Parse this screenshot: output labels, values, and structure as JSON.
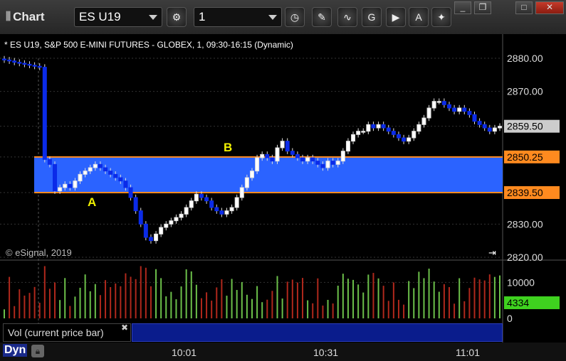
{
  "window": {
    "title": "Chart",
    "min": "_",
    "restore": "❐",
    "max": "□",
    "close": "✕"
  },
  "toolbar": {
    "symbol": "ES U19",
    "interval": "1"
  },
  "chart_info": "* ES U19, S&P 500 E-MINI FUTURES - GLOBEX, 1, 09:30-16:15 (Dynamic)",
  "copyright": "© eSignal, 2019",
  "vol_legend": "Vol (current price bar)",
  "bottom": {
    "dyn": "Dyn",
    "times": [
      "10:01",
      "10:31",
      "11:01"
    ]
  },
  "chart_data": [
    {
      "type": "candlestick",
      "y_ticks": [
        "2880.00",
        "2870.00",
        "2859.50",
        "2850.25",
        "2839.50",
        "2830.00",
        "2820.00"
      ],
      "ylim": [
        2820,
        2880
      ],
      "levels": [
        2850.25,
        2839.5
      ],
      "current_price": "2859.50",
      "zone_color": "#2b63ff",
      "level_color": "#ff8a1f",
      "annotations": [
        "A",
        "B"
      ],
      "closes": [
        2879.5,
        2879.2,
        2878.8,
        2878.5,
        2878.2,
        2877.9,
        2877.6,
        2877.3,
        2849.5,
        2848,
        2840,
        2841,
        2842,
        2841,
        2843,
        2845,
        2846,
        2847,
        2848,
        2847,
        2846,
        2845,
        2844,
        2843,
        2841,
        2838,
        2834,
        2830,
        2826,
        2825,
        2827,
        2829,
        2830,
        2831,
        2832,
        2833,
        2835,
        2837,
        2839,
        2838,
        2837,
        2835,
        2834,
        2833,
        2834,
        2835,
        2838,
        2841,
        2844,
        2846,
        2850,
        2851,
        2850,
        2849,
        2853,
        2855,
        2852,
        2851,
        2850,
        2849,
        2850,
        2849,
        2848,
        2847,
        2849,
        2848,
        2849,
        2852,
        2855,
        2857,
        2858,
        2858,
        2860,
        2859,
        2860,
        2859,
        2858,
        2857,
        2856,
        2855,
        2856,
        2858,
        2860,
        2862,
        2865,
        2867,
        2867,
        2866,
        2865,
        2864,
        2865,
        2864,
        2863,
        2861,
        2860,
        2859,
        2858,
        2859,
        2859.5
      ],
      "volume_ylim": [
        0,
        15000
      ],
      "volume_ticks": [
        "10000",
        "0"
      ],
      "current_volume": "4334"
    }
  ]
}
